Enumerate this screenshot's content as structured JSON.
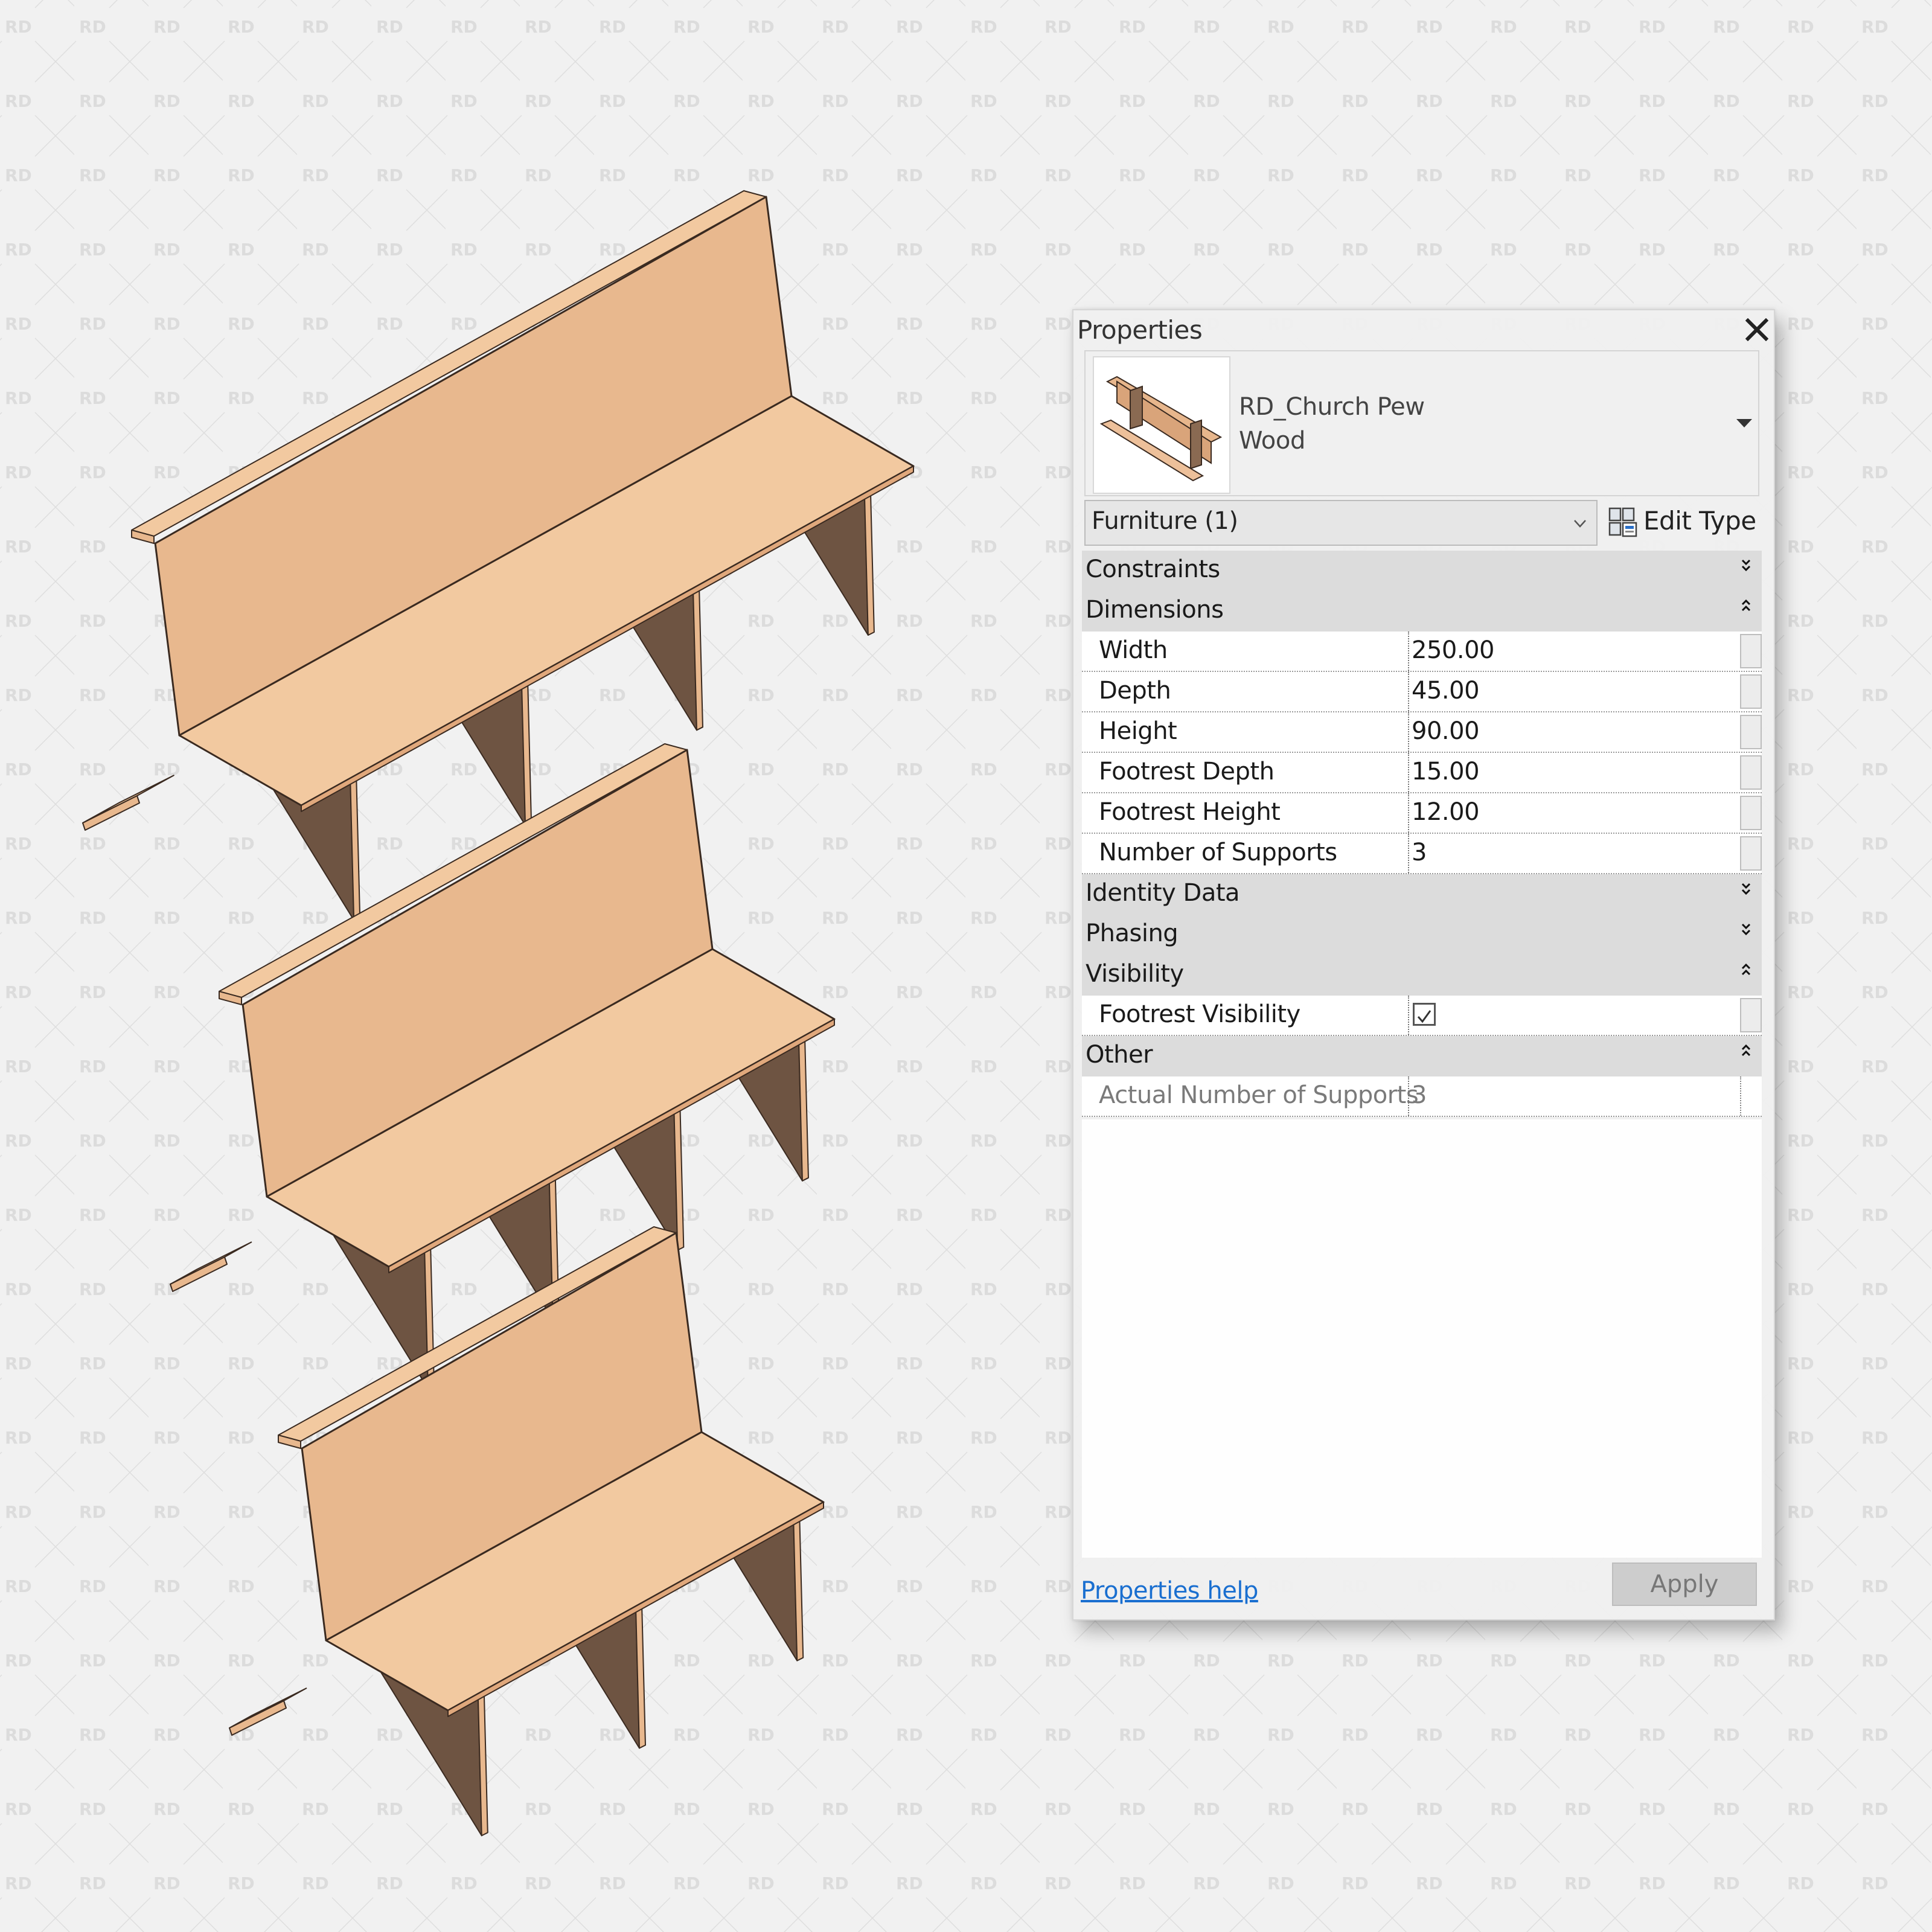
{
  "watermark": {
    "text": "RD"
  },
  "colors": {
    "background": "#f1f1f1",
    "wood_top": "#f2c9a0",
    "wood_front": "#e8b88e",
    "wood_shadow": "#6e5442",
    "edge": "#3a2a20",
    "link": "#1a6fd0",
    "group_header": "#dadada"
  },
  "viewport": {
    "benches": [
      {
        "name": "church-pew-large",
        "supports": 4
      },
      {
        "name": "church-pew-medium",
        "supports": 4
      },
      {
        "name": "church-pew-small",
        "supports": 3
      }
    ]
  },
  "properties_panel": {
    "title": "Properties",
    "close_icon": "close-icon",
    "type_selector": {
      "family": "RD_Church Pew",
      "type": "Wood",
      "dropdown_icon": "triangle-down-icon"
    },
    "category_filter": {
      "value": "Furniture (1)",
      "icon": "chevron-down-icon"
    },
    "edit_type": {
      "label": "Edit Type",
      "icon": "edit-type-icon"
    },
    "groups": [
      {
        "name": "Constraints",
        "expanded": false,
        "rows": []
      },
      {
        "name": "Dimensions",
        "expanded": true,
        "rows": [
          {
            "label": "Width",
            "value": "250.00"
          },
          {
            "label": "Depth",
            "value": "45.00"
          },
          {
            "label": "Height",
            "value": "90.00"
          },
          {
            "label": "Footrest Depth",
            "value": "15.00"
          },
          {
            "label": "Footrest Height",
            "value": "12.00"
          },
          {
            "label": "Number of Supports",
            "value": "3"
          }
        ]
      },
      {
        "name": "Identity Data",
        "expanded": false,
        "rows": []
      },
      {
        "name": "Phasing",
        "expanded": false,
        "rows": []
      },
      {
        "name": "Visibility",
        "expanded": true,
        "rows": [
          {
            "label": "Footrest Visibility",
            "value": true,
            "kind": "checkbox"
          }
        ]
      },
      {
        "name": "Other",
        "expanded": true,
        "rows": [
          {
            "label": "Actual Number of Supports",
            "value": "3",
            "readonly": true
          }
        ]
      }
    ],
    "footer": {
      "help_link": "Properties help",
      "apply_label": "Apply",
      "apply_enabled": false
    }
  }
}
